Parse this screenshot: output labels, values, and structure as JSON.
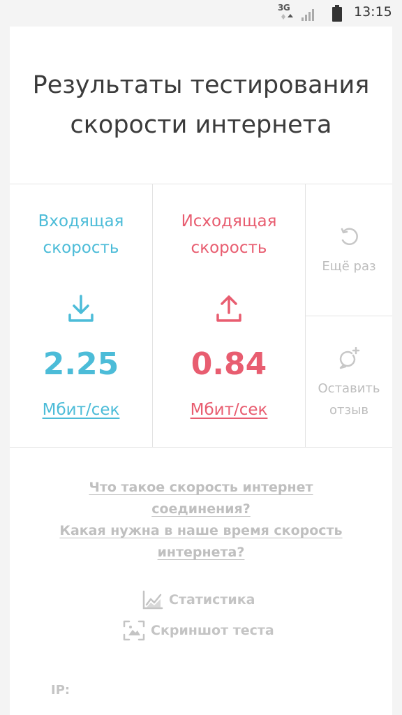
{
  "status_bar": {
    "network": "3G",
    "time": "13:15"
  },
  "title": {
    "line1": "Результаты тестирования",
    "line2": "скорости интернета"
  },
  "download": {
    "label_line1": "Входящая",
    "label_line2": "скорость",
    "icon": "download-icon",
    "value": "2.25",
    "unit": "Мбит/сек"
  },
  "upload": {
    "label_line1": "Исходящая",
    "label_line2": "скорость",
    "icon": "upload-icon",
    "value": "0.84",
    "unit": "Мбит/сек"
  },
  "retry": {
    "icon": "refresh-icon",
    "label": "Ещё раз"
  },
  "review": {
    "icon": "add-comment-icon",
    "label_line1": "Оставить",
    "label_line2": "отзыв"
  },
  "links": {
    "what_is_speed_line1": "Что такое скорость интернет",
    "what_is_speed_line2": "соединения?",
    "needed_speed_line1": "Какая нужна в наше время скорость",
    "needed_speed_line2": "интернета?"
  },
  "actions": {
    "statistics": {
      "icon": "chart-icon",
      "label": "Статистика"
    },
    "screenshot": {
      "icon": "screenshot-icon",
      "label": "Скриншот теста"
    }
  },
  "ip": {
    "label": "IP:"
  },
  "colors": {
    "download": "#4cbcd8",
    "upload": "#e85d70",
    "muted": "#bfbfbf",
    "title": "#3b3b3b"
  }
}
